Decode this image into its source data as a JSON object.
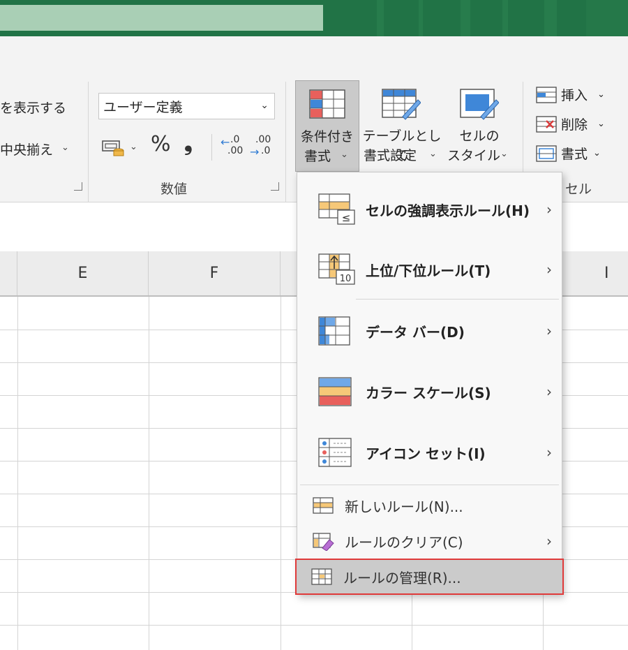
{
  "ribbon": {
    "alignment": {
      "wrap_text_label": "を表示する",
      "merge_center_label": "中央揃え"
    },
    "number": {
      "format_value": "ユーザー定義",
      "percent_symbol": "%",
      "comma_symbol": "❟",
      "increase_decimal_top": ".0",
      "increase_decimal_bottom": ".00",
      "decrease_decimal_top": ".00",
      "decrease_decimal_bottom": ".0",
      "group_label": "数値"
    },
    "styles": {
      "conditional_formatting_line1": "条件付き",
      "conditional_formatting_line2": "書式",
      "format_as_table_line1": "テーブルとして",
      "format_as_table_line2": "書式設定",
      "cell_styles_line1": "セルの",
      "cell_styles_line2": "スタイル"
    },
    "cells": {
      "insert_label": "挿入",
      "delete_label": "削除",
      "format_label": "書式",
      "group_label": "セル"
    }
  },
  "grid": {
    "columns": [
      "E",
      "F",
      "I"
    ]
  },
  "cf_menu": {
    "items": [
      {
        "label": "セルの強調表示ルール(H)",
        "icon": "highlight-cells-rules-icon",
        "has_submenu": true
      },
      {
        "label": "上位/下位ルール(T)",
        "icon": "top-bottom-rules-icon",
        "has_submenu": true
      },
      {
        "label": "データ バー(D)",
        "icon": "data-bars-icon",
        "has_submenu": true
      },
      {
        "label": "カラー スケール(S)",
        "icon": "color-scales-icon",
        "has_submenu": true
      },
      {
        "label": "アイコン セット(I)",
        "icon": "icon-sets-icon",
        "has_submenu": true
      }
    ],
    "new_rule_label": "新しいルール(N)...",
    "clear_rules_label": "ルールのクリア(C)",
    "manage_rules_label": "ルールの管理(R)..."
  },
  "colors": {
    "title_bar": "#217346",
    "selection_highlight": "#e03a3a",
    "ribbon_bg": "#f3f3f3"
  }
}
